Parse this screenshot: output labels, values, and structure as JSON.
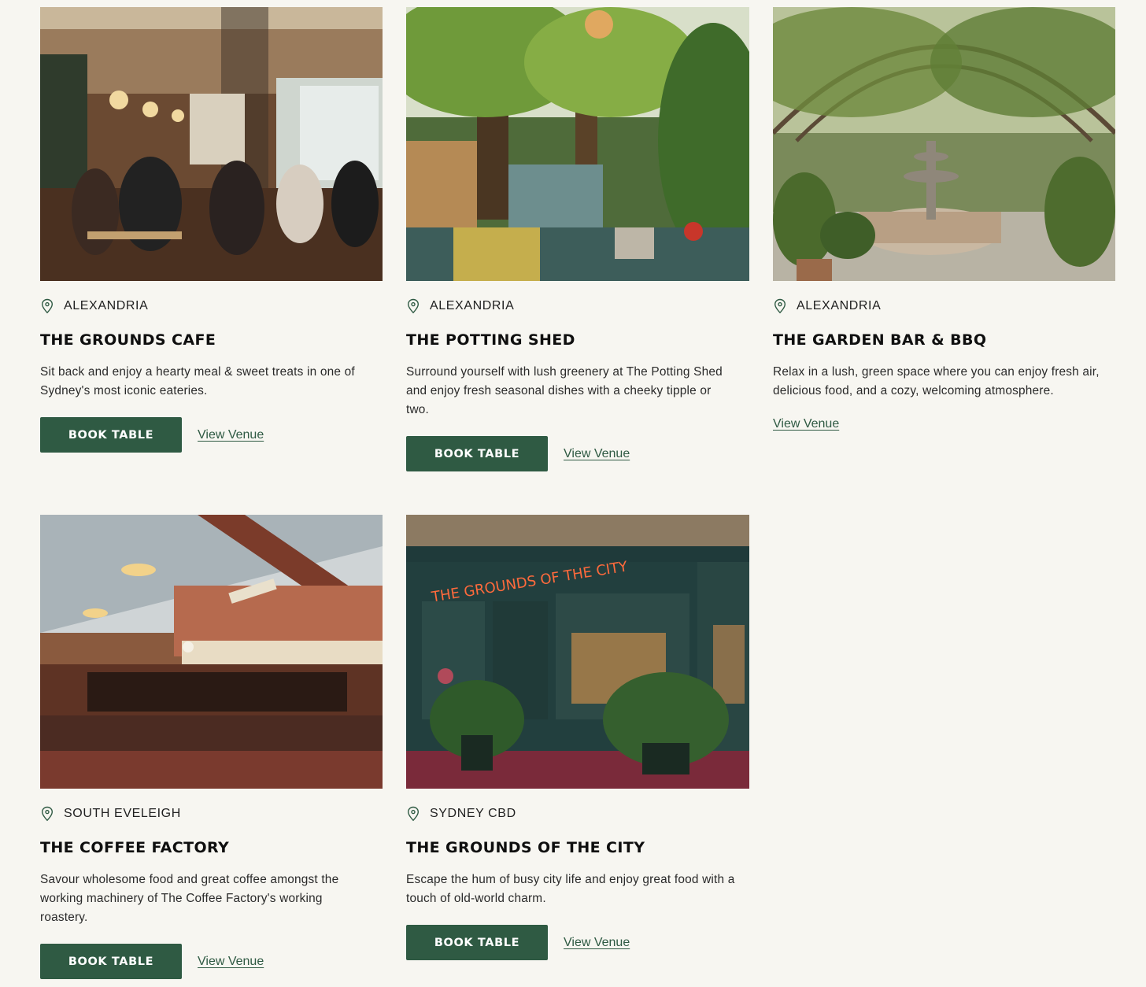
{
  "colors": {
    "background": "#f7f6f1",
    "accent_green": "#2f5a43",
    "text": "#1a1a1a"
  },
  "venues": [
    {
      "location": "ALEXANDRIA",
      "name": "THE GROUNDS CAFE",
      "description": "Sit back and enjoy a hearty meal & sweet treats in one of Sydney's most iconic eateries.",
      "book_label": "BOOK TABLE",
      "view_label": "View Venue",
      "image": "cafe-interior-photo"
    },
    {
      "location": "ALEXANDRIA",
      "name": "THE POTTING SHED",
      "description": "Surround yourself with lush greenery at The Potting Shed and enjoy fresh seasonal dishes with a cheeky tipple or two.",
      "book_label": "BOOK TABLE",
      "view_label": "View Venue",
      "image": "garden-dining-photo"
    },
    {
      "location": "ALEXANDRIA",
      "name": "THE GARDEN BAR & BBQ",
      "description": "Relax in a lush, green space where you can enjoy fresh air, delicious food, and a cozy, welcoming atmosphere.",
      "view_label": "View Venue",
      "image": "garden-fountain-photo"
    },
    {
      "location": "SOUTH EVELEIGH",
      "name": "THE COFFEE FACTORY",
      "description": "Savour wholesome food and great coffee amongst the working machinery of The Coffee Factory's working roastery.",
      "book_label": "BOOK TABLE",
      "view_label": "View Venue",
      "image": "coffee-factory-hall-photo"
    },
    {
      "location": "SYDNEY CBD",
      "name": "THE GROUNDS OF THE CITY",
      "description": "Escape the hum of busy city life and enjoy great food with a touch of old-world charm.",
      "book_label": "BOOK TABLE",
      "view_label": "View Venue",
      "image": "city-storefront-photo",
      "neon_sign": "THE GROUNDS OF THE CITY"
    }
  ]
}
